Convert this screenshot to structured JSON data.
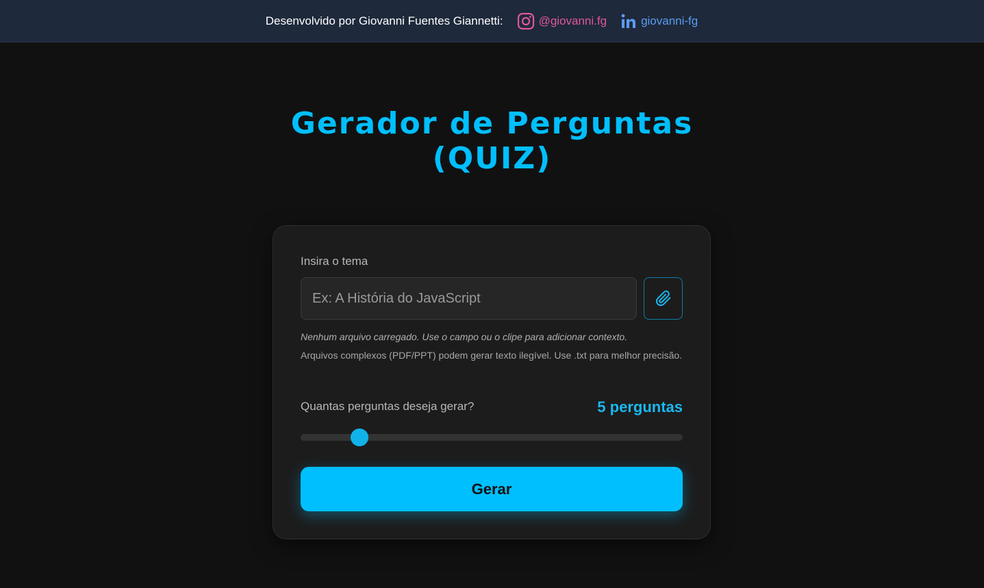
{
  "header": {
    "developed_by": "Desenvolvido por Giovanni Fuentes Giannetti:",
    "instagram": {
      "handle": "@giovanni.fg",
      "icon": "instagram-icon",
      "color": "#e056a0"
    },
    "linkedin": {
      "handle": "giovanni-fg",
      "icon": "linkedin-icon",
      "color": "#5b9bf0"
    }
  },
  "title": {
    "line1": "Gerador de Perguntas",
    "line2": "(QUIZ)",
    "color": "#00bfff"
  },
  "form": {
    "theme_label": "Insira o tema",
    "theme_placeholder": "Ex: A História do JavaScript",
    "attach_icon": "paperclip-icon",
    "file_status": "Nenhum arquivo carregado. Use o campo ou o clipe para adicionar contexto.",
    "file_hint": "Arquivos complexos (PDF/PPT) podem gerar texto ilegível. Use .txt para melhor precisão.",
    "count_label": "Quantas perguntas deseja gerar?",
    "count_value": "5 perguntas",
    "slider_fraction": 0.155,
    "generate_label": "Gerar"
  }
}
